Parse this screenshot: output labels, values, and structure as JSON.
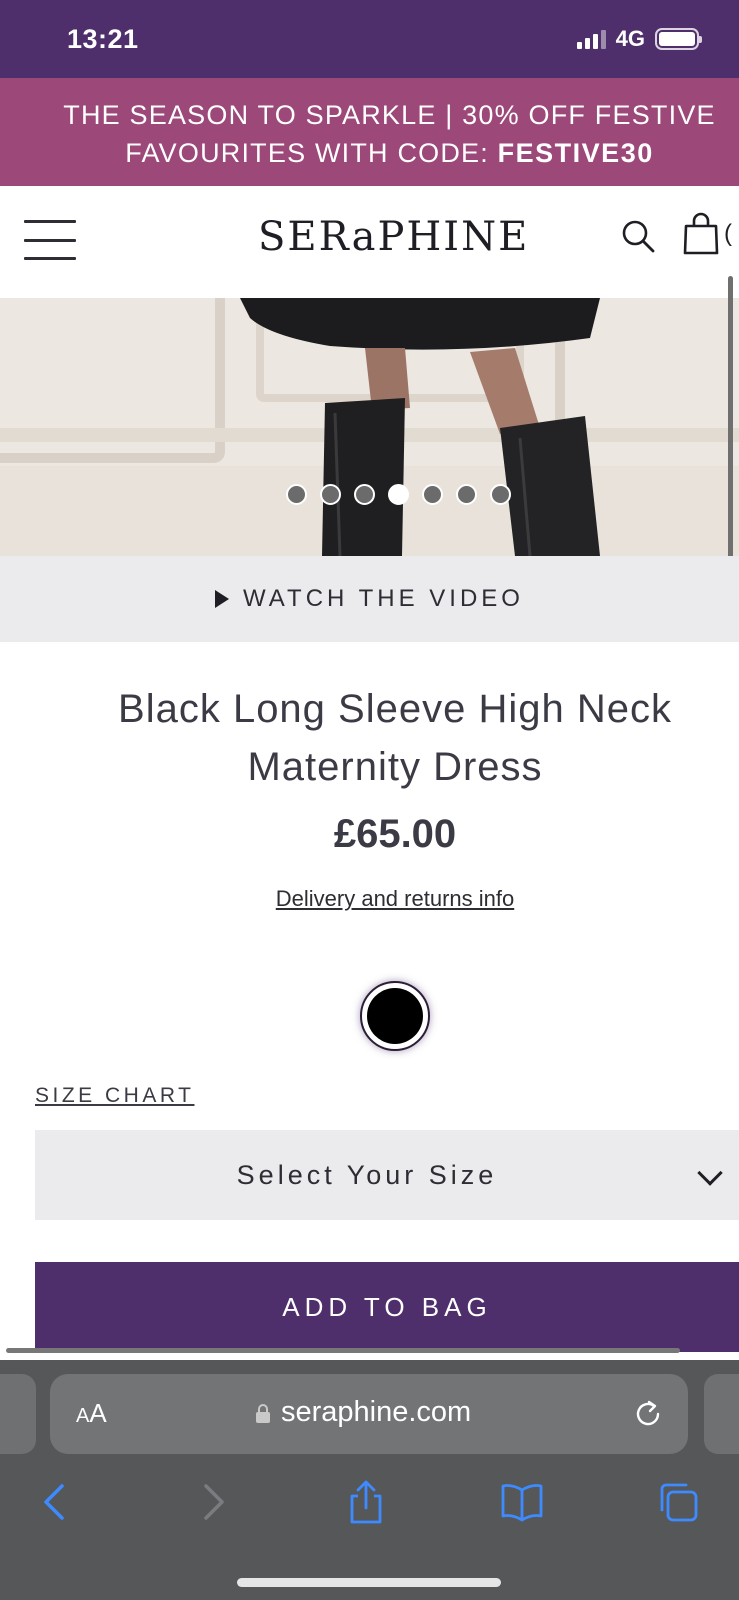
{
  "status_bar": {
    "time": "13:21",
    "network": "4G"
  },
  "promo": {
    "line1": "THE SEASON TO SPARKLE | 30% OFF FESTIVE",
    "line2_prefix": "FAVOURITES WITH CODE: ",
    "code": "FESTIVE30"
  },
  "header": {
    "logo": "SERaPHINE",
    "bag_count": "("
  },
  "gallery": {
    "dot_count": 7,
    "active_index": 3
  },
  "video": {
    "label": "WATCH THE VIDEO"
  },
  "product": {
    "title": "Black Long Sleeve High Neck Maternity Dress",
    "price": "£65.00",
    "delivery_link": "Delivery and returns info",
    "swatch_color": "#000000"
  },
  "size": {
    "chart_link": "SIZE CHART",
    "select_label": "Select Your Size"
  },
  "cta": {
    "add_to_bag": "ADD TO BAG"
  },
  "browser": {
    "text_size_big": "A",
    "text_size_small": "A",
    "url": "seraphine.com"
  },
  "colors": {
    "brand_purple": "#4f2f6b",
    "promo_pink": "#9c4879",
    "safari_blue": "#3d8bff"
  }
}
